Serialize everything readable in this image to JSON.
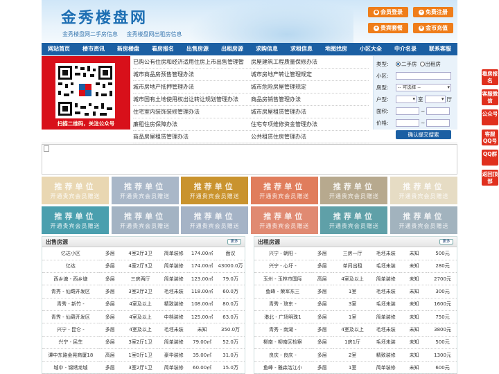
{
  "header": {
    "logo": "金秀楼盘网",
    "sub1": "金秀楼盘网二手房信息",
    "sub2": "金秀楼盘网出租房信息",
    "buttons": [
      "会员登录",
      "免费注册",
      "贵宾套餐",
      "金币充值"
    ]
  },
  "nav": [
    "网站首页",
    "楼市资讯",
    "新房楼盘",
    "看房报名",
    "出售房源",
    "出租房源",
    "求购信息",
    "求租信息",
    "地图找房",
    "小区大全",
    "中介名录",
    "联系客服"
  ],
  "qr": {
    "caption": "扫描二维码，关注公众号"
  },
  "links": [
    [
      "已购公有住房和经济适用住房上市出售管理暂",
      "房屋建筑工程质量保修办法"
    ],
    [
      "城市商品房预售管理办法",
      "城市房地产转让管理规定"
    ],
    [
      "城市房地产抵押管理办法",
      "城市危险房屋管理规定"
    ],
    [
      "城市国有土地使用权出让转让规划管理办法",
      "商品房销售管理办法"
    ],
    [
      "住宅室内装饰装修管理办法",
      "城市房屋租赁管理办法"
    ],
    [
      "廉租住房保障办法",
      "住宅专项维修资金管理办法"
    ],
    [
      "商品房屋租赁管理办法",
      "公共租赁住房管理办法"
    ]
  ],
  "search": {
    "type_label": "类型:",
    "type_opt1": "二手房",
    "type_opt2": "出租房",
    "community_label": "小区:",
    "room_label": "房型:",
    "room_value": "-- 可选择 --",
    "layout_label": "户型:",
    "unit_room": "室",
    "unit_hall": "厅",
    "area_label": "面积:",
    "price_label": "价格:",
    "range_sep": "~",
    "submit": "确认提交搜索"
  },
  "ads": {
    "title": "推荐单位",
    "subtitle": "开通贵宾会员赠送",
    "colors": [
      "#e9d7b2",
      "#a9b7c8",
      "#c9932e",
      "#e07d5c",
      "#b7a98e",
      "#e6dcc4",
      "#4a9fae",
      "#a3b3c3",
      "#a5b3c6",
      "#e08a72",
      "#5fa0a8",
      "#a2b3be"
    ]
  },
  "sale": {
    "title": "出售房源",
    "more": "更多",
    "rows": [
      [
        "亿达小区",
        "多层",
        "4室2厅3卫",
        "简单装修",
        "174.00㎡",
        "面议"
      ],
      [
        "亿达",
        "多层",
        "4室2厅3卫",
        "简单装修",
        "174.00㎡",
        "43000.0万"
      ],
      [
        "西乡塘 - 西乡塘",
        "多层",
        "三房两厅",
        "简单装修",
        "123.00㎡",
        "79.0万"
      ],
      [
        "青秀 - 仙葫开发区",
        "多层",
        "3室2厅2卫",
        "毛坯未装",
        "118.00㎡",
        "60.0万"
      ],
      [
        "青秀 - 新竹 -",
        "多层",
        "4室及以上",
        "精致装修",
        "108.00㎡",
        "80.0万"
      ],
      [
        "青秀 - 仙葫开发区",
        "多层",
        "4室及以上",
        "中档装修",
        "125.00㎡",
        "63.0万"
      ],
      [
        "兴宁 - 昆仑 -",
        "多层",
        "4室及以上",
        "毛坯未装",
        "未知",
        "350.0万"
      ],
      [
        "兴宁 - 民生",
        "多层",
        "3室2厅1卫",
        "简单装修",
        "79.00㎡",
        "52.0万"
      ],
      [
        "谭中东路金晃商厦18",
        "高层",
        "1室0厅1卫",
        "豪华装修",
        "35.00㎡",
        "31.0万"
      ],
      [
        "城中 - 锦绣龙城",
        "多层",
        "3室2厅1卫",
        "简单装修",
        "60.00㎡",
        "15.0万"
      ]
    ]
  },
  "rent": {
    "title": "出租房源",
    "more": "更多",
    "rows": [
      [
        "兴宁 - 朝阳 -",
        "多层",
        "三房一厅",
        "毛坯未装",
        "未知",
        "500元"
      ],
      [
        "兴宁 - 心圩 -",
        "多层",
        "单间出租",
        "毛坯未装",
        "未知",
        "280元"
      ],
      [
        "玉州 - 玉林市国际",
        "高层",
        "4室及以上",
        "简单装修",
        "未知",
        "2700元"
      ],
      [
        "鱼峰 - 荣军东三",
        "多层",
        "1室",
        "毛坯未装",
        "未知",
        "300元"
      ],
      [
        "青秀 - 琅东 -",
        "多层",
        "3室",
        "毛坯未装",
        "未知",
        "1600元"
      ],
      [
        "港北 - 广场明珠1",
        "多层",
        "1室",
        "简单装修",
        "未知",
        "750元"
      ],
      [
        "青秀 - 南湖 -",
        "多层",
        "4室及以上",
        "毛坯未装",
        "未知",
        "3800元"
      ],
      [
        "柳南 - 柳南区检察",
        "多层",
        "1房1厅",
        "毛坯未装",
        "未知",
        "500元"
      ],
      [
        "良庆 - 良庆 -",
        "多层",
        "2室",
        "精致装修",
        "未知",
        "1300元"
      ],
      [
        "鱼峰 - 雅森洛江小",
        "多层",
        "1室",
        "简单装修",
        "未知",
        "600元"
      ]
    ]
  },
  "side": [
    "看房报名",
    "客服微信",
    "公众号",
    "客服QQ号",
    "QQ群",
    "返回顶部"
  ]
}
